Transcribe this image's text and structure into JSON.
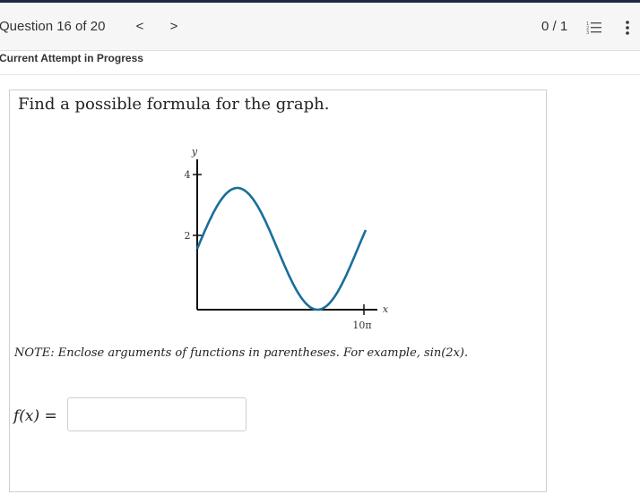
{
  "header": {
    "question_label": "Question 16 of 20",
    "prev_glyph": "<",
    "next_glyph": ">",
    "score": "0 / 1",
    "list_icon": "list-icon",
    "more_icon": "vertical-ellipsis-icon"
  },
  "status": {
    "attempt": "Current Attempt in Progress"
  },
  "problem": {
    "prompt": "Find a possible formula for the graph.",
    "graph": {
      "y_axis_label": "y",
      "x_axis_label": "x",
      "y_ticks": [
        "4",
        "2"
      ],
      "x_tick": "10π",
      "curve_color": "#1a6e9a"
    },
    "note": "NOTE: Enclose arguments of functions in parentheses. For example, sin(2x).",
    "answer_label": "f(x) =",
    "answer_value": ""
  }
}
